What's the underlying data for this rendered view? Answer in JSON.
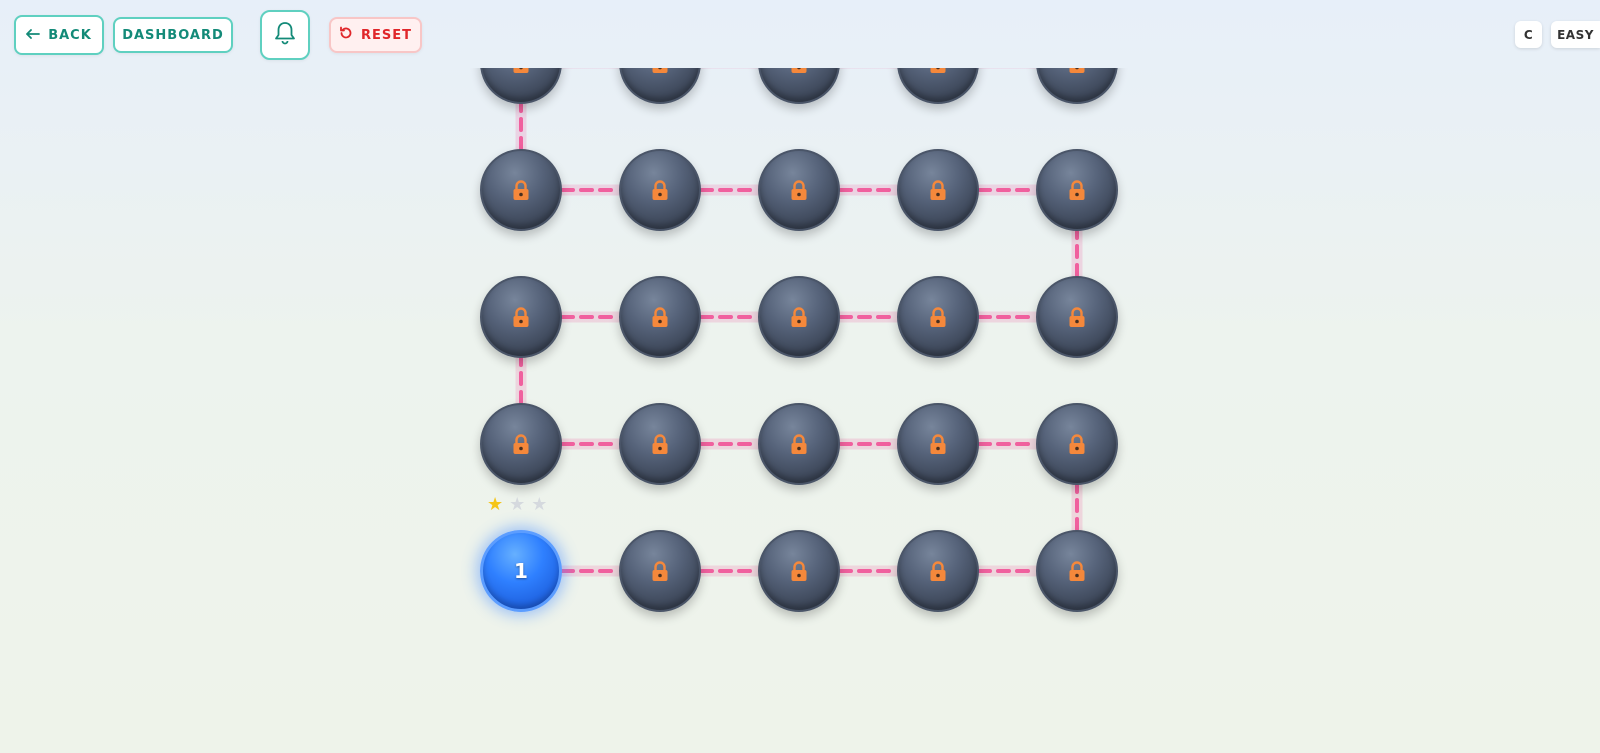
{
  "toolbar": {
    "back_label": "BACK",
    "back_icon": "arrow-left-icon",
    "dashboard_label": "DASHBOARD",
    "notifications_icon": "bell-icon",
    "reset_label": "RESET",
    "reset_icon": "refresh-icon",
    "grade_label": "C",
    "difficulty_label": "EASY"
  },
  "colors": {
    "accent": "#138a78",
    "reset": "#e0262a",
    "path": "#f0609e",
    "lock": "#f5883b",
    "current_node": "#2f80ff",
    "locked_node": "#4a5568",
    "star_filled": "#f5c518",
    "star_empty": "#d5d9de"
  },
  "level_map": {
    "columns": 5,
    "rows_visible": 5,
    "rows": [
      {
        "row": 1,
        "levels": [
          {
            "number": "1",
            "state": "current",
            "stars": 1,
            "max_stars": 3
          },
          {
            "state": "locked"
          },
          {
            "state": "locked"
          },
          {
            "state": "locked"
          },
          {
            "state": "locked"
          }
        ]
      },
      {
        "row": 2,
        "levels": [
          {
            "state": "locked"
          },
          {
            "state": "locked"
          },
          {
            "state": "locked"
          },
          {
            "state": "locked"
          },
          {
            "state": "locked"
          }
        ]
      },
      {
        "row": 3,
        "levels": [
          {
            "state": "locked"
          },
          {
            "state": "locked"
          },
          {
            "state": "locked"
          },
          {
            "state": "locked"
          },
          {
            "state": "locked"
          }
        ]
      },
      {
        "row": 4,
        "levels": [
          {
            "state": "locked"
          },
          {
            "state": "locked"
          },
          {
            "state": "locked"
          },
          {
            "state": "locked"
          },
          {
            "state": "locked"
          }
        ]
      },
      {
        "row": 5,
        "levels": [
          {
            "state": "locked"
          },
          {
            "state": "locked"
          },
          {
            "state": "locked"
          },
          {
            "state": "locked"
          },
          {
            "state": "locked"
          }
        ]
      }
    ],
    "locked_icon": "lock-icon",
    "star_icon": "star-icon"
  }
}
